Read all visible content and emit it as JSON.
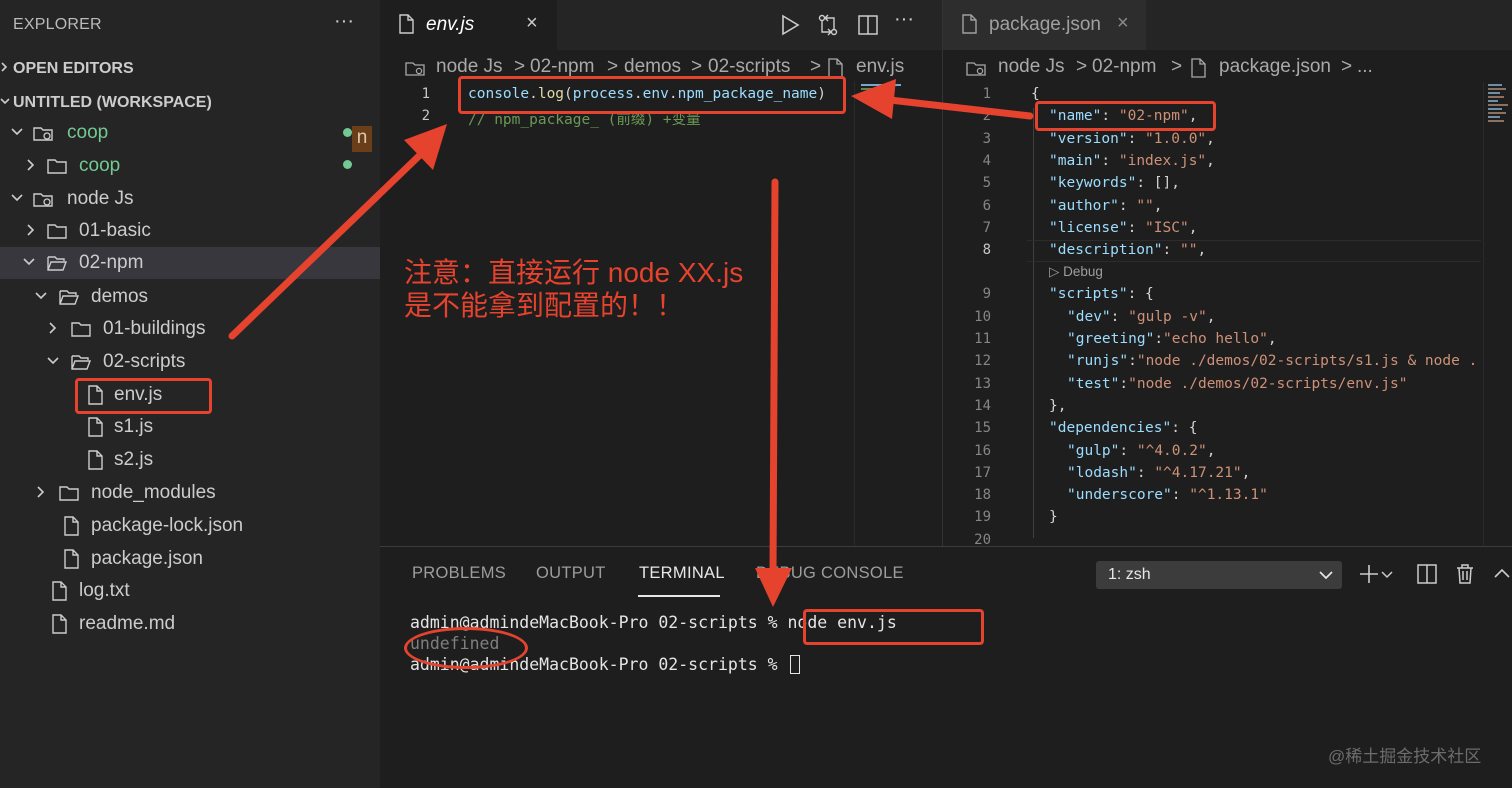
{
  "sidebar": {
    "title": "EXPLORER",
    "more": "···",
    "sections": {
      "open_editors": "OPEN EDITORS",
      "workspace": "UNTITLED (WORKSPACE)"
    },
    "items": [
      {
        "label": "coop",
        "kind": "root",
        "expanded": true
      },
      {
        "label": "coop",
        "kind": "folder",
        "expanded": false
      },
      {
        "label": "node Js",
        "kind": "root",
        "expanded": true
      },
      {
        "label": "01-basic",
        "kind": "folder",
        "expanded": false
      },
      {
        "label": "02-npm",
        "kind": "folder",
        "expanded": true
      },
      {
        "label": "demos",
        "kind": "folder",
        "expanded": true
      },
      {
        "label": "01-buildings",
        "kind": "folder",
        "expanded": false
      },
      {
        "label": "02-scripts",
        "kind": "folder",
        "expanded": true
      },
      {
        "label": "env.js",
        "kind": "file"
      },
      {
        "label": "s1.js",
        "kind": "file"
      },
      {
        "label": "s2.js",
        "kind": "file"
      },
      {
        "label": "node_modules",
        "kind": "folder",
        "expanded": false
      },
      {
        "label": "package-lock.json",
        "kind": "file"
      },
      {
        "label": "package.json",
        "kind": "file"
      },
      {
        "label": "log.txt",
        "kind": "file"
      },
      {
        "label": "readme.md",
        "kind": "file"
      }
    ],
    "coop_badge": "n"
  },
  "editor_left": {
    "tab": {
      "label": "env.js",
      "close": "×"
    },
    "breadcrumb": [
      "node Js",
      "02-npm",
      "demos",
      "02-scripts",
      "env.js"
    ],
    "sep": ">",
    "lines": [
      {
        "num": "1",
        "tokens": [
          {
            "t": "console",
            "c": "c-var"
          },
          {
            "t": ".",
            "c": "c-def"
          },
          {
            "t": "log",
            "c": "c-fn"
          },
          {
            "t": "(",
            "c": "c-def"
          },
          {
            "t": "process",
            "c": "c-var"
          },
          {
            "t": ".",
            "c": "c-def"
          },
          {
            "t": "env",
            "c": "c-var"
          },
          {
            "t": ".",
            "c": "c-def"
          },
          {
            "t": "npm_package_name",
            "c": "c-var"
          },
          {
            "t": ")",
            "c": "c-def"
          }
        ]
      },
      {
        "num": "2",
        "tokens": [
          {
            "t": "// npm_package_ (前缀) +变量",
            "c": "c-com"
          }
        ]
      }
    ]
  },
  "editor_right": {
    "tab": {
      "label": "package.json",
      "close": "×"
    },
    "breadcrumb": [
      "node Js",
      "02-npm",
      "package.json",
      "..."
    ],
    "sep": ">",
    "codelens": "▷ Debug",
    "lines": [
      {
        "num": "1",
        "text": "{"
      },
      {
        "num": "2",
        "key": "\"name\"",
        "val": "\"02-npm\"",
        "tail": ",",
        "indent": 1
      },
      {
        "num": "3",
        "key": "\"version\"",
        "val": "\"1.0.0\"",
        "tail": ",",
        "indent": 1
      },
      {
        "num": "4",
        "key": "\"main\"",
        "val": "\"index.js\"",
        "tail": ",",
        "indent": 1
      },
      {
        "num": "5",
        "key": "\"keywords\"",
        "val": "[]",
        "tail": ",",
        "indent": 1
      },
      {
        "num": "6",
        "key": "\"author\"",
        "val": "\"\"",
        "tail": ",",
        "indent": 1
      },
      {
        "num": "7",
        "key": "\"license\"",
        "val": "\"ISC\"",
        "tail": ",",
        "indent": 1
      },
      {
        "num": "8",
        "key": "\"description\"",
        "val": "\"\"",
        "tail": ",",
        "indent": 1
      },
      {
        "num": "9",
        "key": "\"scripts\"",
        "val": "{",
        "tail": "",
        "indent": 1
      },
      {
        "num": "10",
        "key": "\"dev\"",
        "val": "\"gulp -v\"",
        "tail": ",",
        "indent": 2
      },
      {
        "num": "11",
        "key": "\"greeting\"",
        "val": "\"echo hello\"",
        "tail": ",",
        "indent": 2,
        "tight": true
      },
      {
        "num": "12",
        "key": "\"runjs\"",
        "val": "\"node ./demos/02-scripts/s1.js & node .",
        "tail": "",
        "indent": 2,
        "tight": true
      },
      {
        "num": "13",
        "key": "\"test\"",
        "val": "\"node ./demos/02-scripts/env.js\"",
        "tail": "",
        "indent": 2,
        "tight": true
      },
      {
        "num": "14",
        "text": "},",
        "indent": 1
      },
      {
        "num": "15",
        "key": "\"dependencies\"",
        "val": "{",
        "tail": "",
        "indent": 1
      },
      {
        "num": "16",
        "key": "\"gulp\"",
        "val": "\"^4.0.2\"",
        "tail": ",",
        "indent": 2
      },
      {
        "num": "17",
        "key": "\"lodash\"",
        "val": "\"^4.17.21\"",
        "tail": ",",
        "indent": 2
      },
      {
        "num": "18",
        "key": "\"underscore\"",
        "val": "\"^1.13.1\"",
        "tail": "",
        "indent": 2
      },
      {
        "num": "19",
        "text": "}",
        "indent": 1
      },
      {
        "num": "20",
        "text": ""
      }
    ]
  },
  "panel": {
    "tabs": [
      "PROBLEMS",
      "OUTPUT",
      "TERMINAL",
      "DEBUG CONSOLE"
    ],
    "active_tab": "TERMINAL",
    "terminal_select": "1: zsh",
    "lines": [
      "admin@admindeMacBook-Pro 02-scripts % node env.js",
      "undefined",
      "admin@admindeMacBook-Pro 02-scripts % "
    ]
  },
  "annotation": {
    "line1": "注意：直接运行 node XX.js",
    "line2": "是不能拿到配置的！！",
    "color": "#e5432d"
  },
  "watermark": "@稀土掘金技术社区",
  "colors": {
    "sidebar_bg": "#252526",
    "editor_bg": "#1e1e1e",
    "git_added": "#73c991",
    "git_modified_highlight": "#6b3e1a",
    "annotation_red": "#e5432d"
  }
}
